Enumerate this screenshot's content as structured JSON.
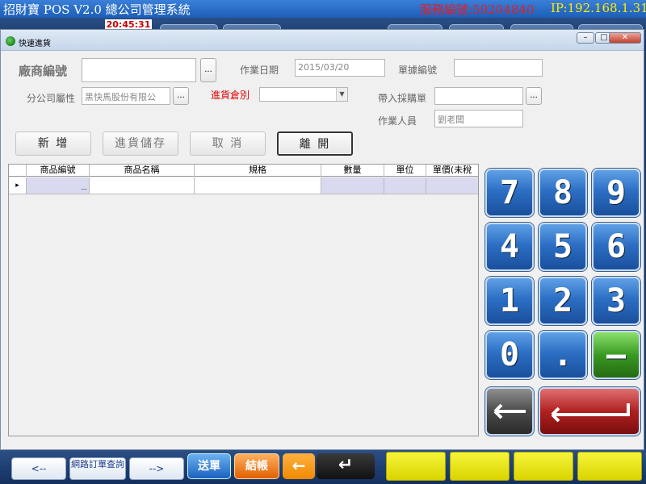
{
  "top_bar": {
    "title": "招財寶 POS V2.0 總公司管理系統",
    "serial": "服務編號:59204840",
    "ip": "IP:192.168.1.31",
    "clock": "20:45:31"
  },
  "dialog": {
    "title": "快速進貨",
    "min_label": "–",
    "max_label": "□",
    "close_label": "✕"
  },
  "form": {
    "vendor_no_label": "廠商編號",
    "vendor_no_value": "",
    "lookup_label": "...",
    "work_date_label": "作業日期",
    "work_date_value": "2015/03/20",
    "doc_no_label": "單據編號",
    "doc_no_value": "",
    "branch_label": "分公司屬性",
    "branch_value": "黑快馬股份有限公",
    "warehouse_label": "進貨倉別",
    "warehouse_value": "",
    "purchase_order_label": "帶入採購單",
    "purchase_order_value": "",
    "operator_label": "作業人員",
    "operator_value": "劉老闆"
  },
  "actions": {
    "add": "新 增",
    "save": "進貨儲存",
    "cancel": "取 消",
    "leave": "離 開"
  },
  "grid": {
    "columns": [
      "商品編號",
      "商品名稱",
      "規格",
      "數量",
      "單位",
      "單價(未稅"
    ],
    "row_indicator": "▸",
    "cell_button": "..."
  },
  "keypad": {
    "keys": [
      "7",
      "8",
      "9",
      "4",
      "5",
      "6",
      "1",
      "2",
      "3",
      "0",
      ".",
      "–"
    ],
    "backspace_icon": "backspace-arrow-icon",
    "enter_icon": "enter-arrow-icon"
  },
  "bottom_bar": {
    "prev": "<--",
    "online_query": "網路訂單查詢",
    "next": "-->",
    "send_label": "送單",
    "checkout_label": "結帳",
    "back_arrow": "←",
    "enter_arrow": "↵"
  },
  "colors": {
    "title_bar": "#1d5fb8",
    "serial_text": "#e0202a",
    "ip_text": "#ffea00",
    "key_blue": "#2c6fc4",
    "key_green": "#3a9a22",
    "key_red": "#b02020",
    "yellow_button": "#d9d400"
  }
}
